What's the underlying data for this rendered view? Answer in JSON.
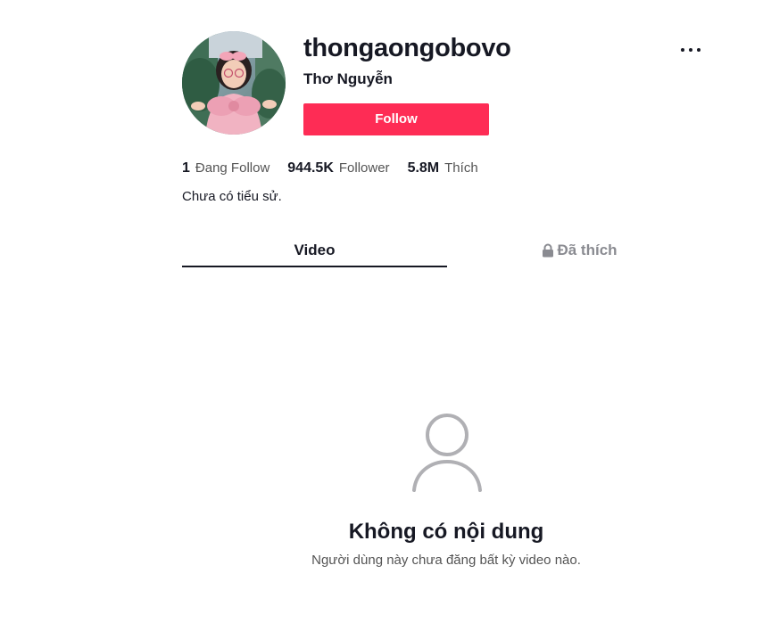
{
  "profile": {
    "username": "thongaongobovo",
    "nickname": "Thơ Nguyễn",
    "follow_label": "Follow",
    "bio": "Chưa có tiểu sử."
  },
  "stats": [
    {
      "value": "1",
      "label": "Đang Follow"
    },
    {
      "value": "944.5K",
      "label": "Follower"
    },
    {
      "value": "5.8M",
      "label": "Thích"
    }
  ],
  "tabs": [
    {
      "label": "Video",
      "active": true
    },
    {
      "label": "Đã thích",
      "active": false,
      "icon": "lock-icon"
    }
  ],
  "empty_state": {
    "icon": "user-icon",
    "title": "Không có nội dung",
    "description": "Người dùng này chưa đăng bất kỳ video nào."
  },
  "colors": {
    "accent": "#fe2c55",
    "text": "#161823",
    "muted": "#8a8b91"
  }
}
